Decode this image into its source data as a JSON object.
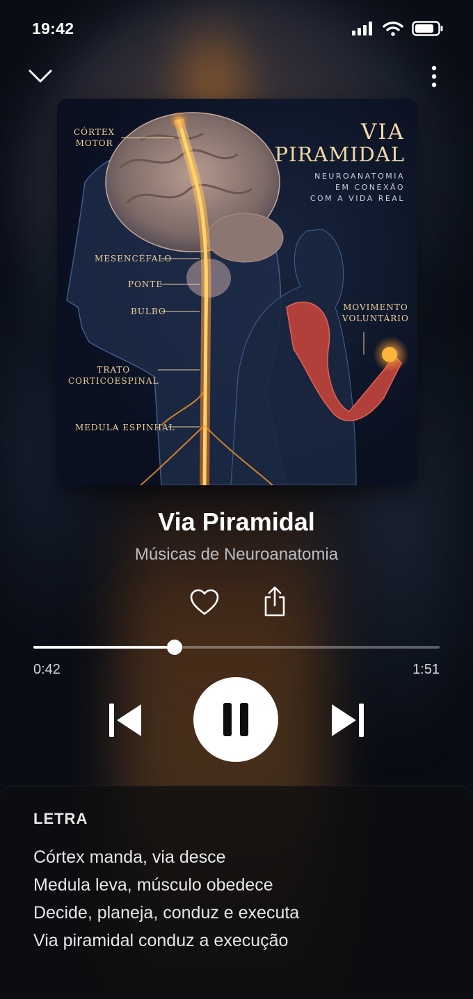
{
  "status_bar": {
    "time": "19:42"
  },
  "album_art": {
    "title_line1": "VIA",
    "title_line2": "PIRAMIDAL",
    "subtitle_lines": [
      "NEUROANATOMIA",
      "EM CONEXÃO",
      "COM A VIDA REAL"
    ],
    "labels": {
      "cortex_motor": [
        "CÓRTEX",
        "MOTOR"
      ],
      "mesencefalo": "MESENCÉFALO",
      "ponte": "PONTE",
      "bulbo": "BULBO",
      "trato": [
        "TRATO",
        "CORTICOESPINAL"
      ],
      "medula": "MEDULA ESPINHAL",
      "movimento": [
        "MOVIMENTO",
        "VOLUNTÁRIO"
      ]
    }
  },
  "song": {
    "title": "Via Piramidal",
    "artist": "Músicas de Neuroanatomia"
  },
  "progress": {
    "elapsed": "0:42",
    "total": "1:51",
    "fraction": 0.348
  },
  "lyrics": {
    "header": "LETRA",
    "lines": [
      "Córtex manda, via desce",
      "Medula leva, músculo obedece",
      "Decide, planeja, conduz e executa",
      "Via piramidal conduz a execução"
    ]
  },
  "colors": {
    "accent": "#ffffff",
    "art_label": "#f0d19a",
    "signal": "#ff9a2a"
  }
}
